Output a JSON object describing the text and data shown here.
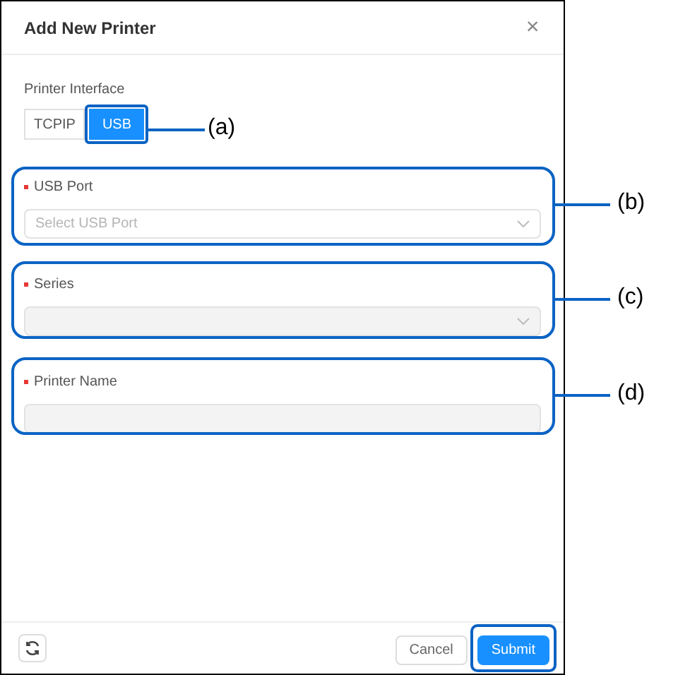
{
  "window": {
    "title": "Add New Printer",
    "close": "×"
  },
  "printer_interface": {
    "label": "Printer Interface",
    "options": [
      {
        "label": "TCPIP",
        "selected": false
      },
      {
        "label": "USB",
        "selected": true
      }
    ]
  },
  "fields": [
    {
      "kind": "select",
      "label": "USB Port",
      "required": true,
      "placeholder": "Select USB Port",
      "disabled": false
    },
    {
      "kind": "select",
      "label": "Series",
      "required": true,
      "disabled": true
    },
    {
      "kind": "input",
      "label": "Printer Name",
      "required": true,
      "disabled": true
    }
  ],
  "footer": {
    "buttons": [
      {
        "kind": "secondary",
        "label": "Cancel",
        "highlighted": false
      },
      {
        "kind": "primary",
        "label": "Submit",
        "highlighted": true
      }
    ]
  },
  "callouts": [
    {
      "label": "(a)"
    },
    {
      "label": "(b)"
    },
    {
      "label": "(c)"
    },
    {
      "label": "(d)"
    }
  ]
}
